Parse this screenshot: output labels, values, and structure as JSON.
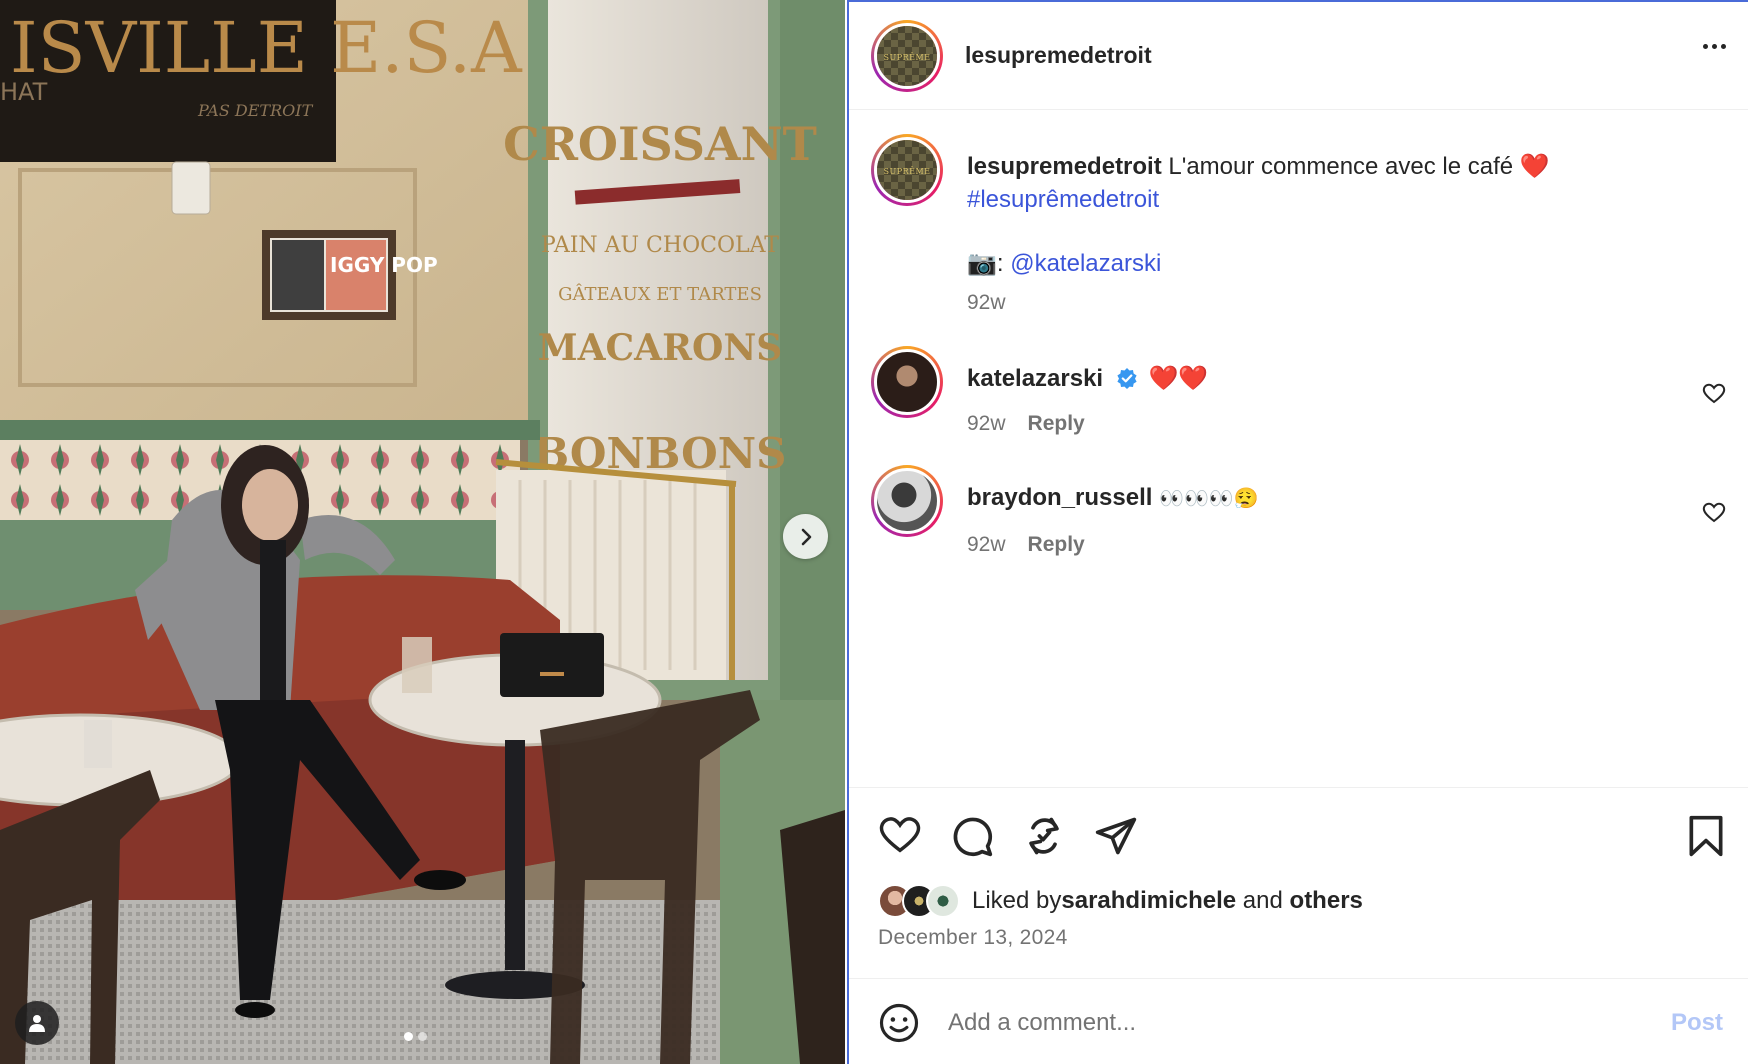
{
  "post": {
    "username": "lesupremedetroit",
    "avatar_text": "SUPRÊME",
    "more_icon": "more-horizontal-icon"
  },
  "photo": {
    "sign_text": "ISVILLE E.S.A.",
    "sign_sub_left": "HAT",
    "sign_sub_right": "PAS DETROIT",
    "poster_text": "IGGY POP",
    "window_lines": [
      "CROISSANT",
      "PAIN AU CHOCOLAT",
      "GÂTEAUX ET TARTES",
      "MACARONS",
      "BONBONS"
    ],
    "carousel_dots": 2,
    "active_dot": 0
  },
  "caption": {
    "username": "lesupremedetroit",
    "text": "L'amour commence avec le café ❤️",
    "hashtag": "#lesuprêmedetroit",
    "credit_prefix": "📷: ",
    "credit_mention": "@katelazarski",
    "time": "92w"
  },
  "comments": [
    {
      "username": "katelazarski",
      "verified": true,
      "text": "❤️❤️",
      "time": "92w",
      "reply_label": "Reply"
    },
    {
      "username": "braydon_russell",
      "verified": false,
      "text": "👀👀👀😮‍💨",
      "time": "92w",
      "reply_label": "Reply"
    }
  ],
  "actions": {
    "icons": [
      "heart-icon",
      "comment-icon",
      "repost-icon",
      "share-icon",
      "bookmark-icon"
    ]
  },
  "likes": {
    "prefix": "Liked by ",
    "user": "sarahdimichele",
    "middle": " and ",
    "others": "others"
  },
  "date": "December 13, 2024",
  "comment_box": {
    "placeholder": "Add a comment...",
    "post_label": "Post"
  },
  "colors": {
    "link": "#3b55d9",
    "post_disabled": "#b3c7f7",
    "focus_border": "#4a6bd8"
  }
}
